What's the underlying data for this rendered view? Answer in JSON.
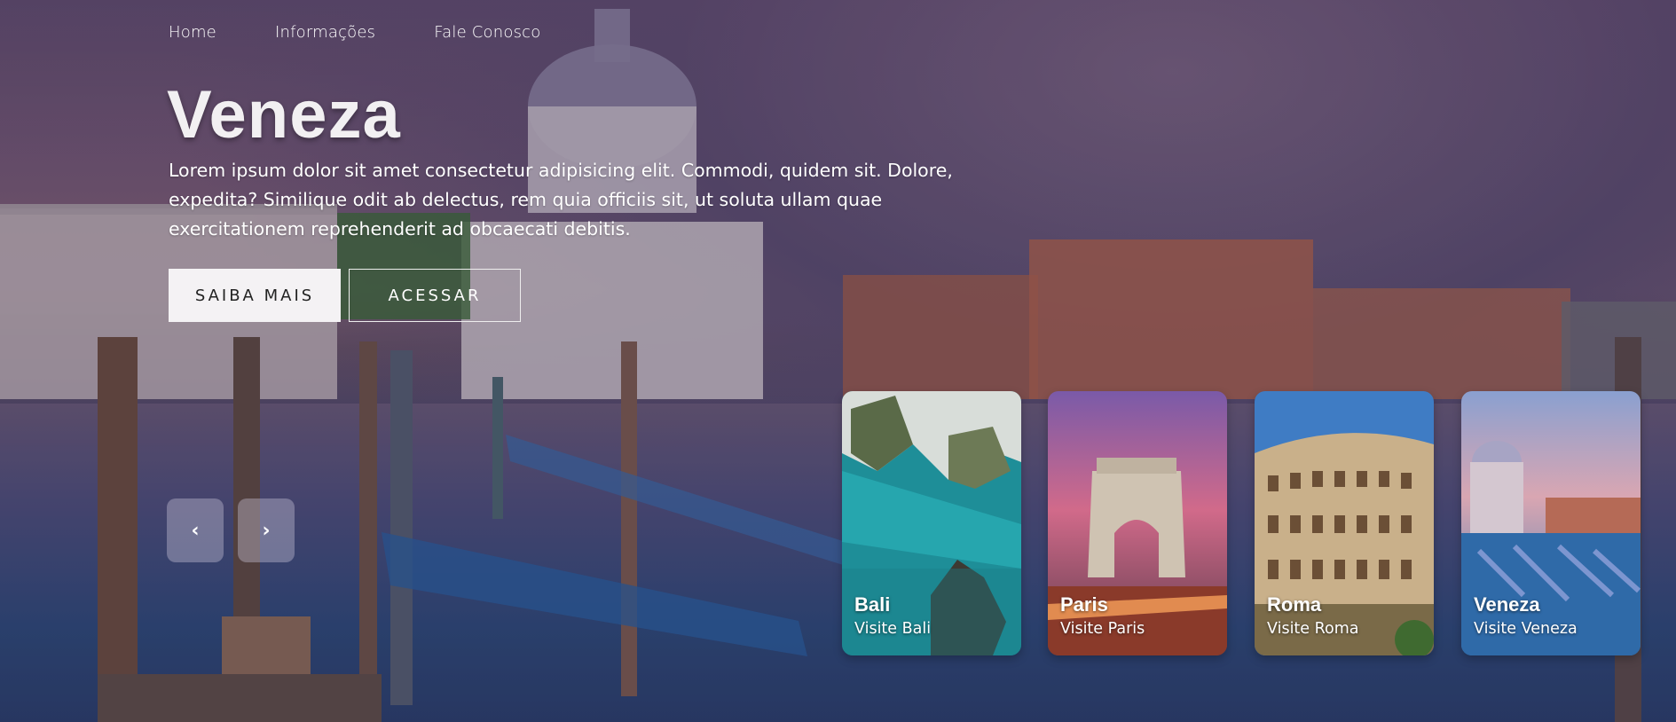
{
  "nav": {
    "items": [
      {
        "label": "Home"
      },
      {
        "label": "Informações"
      },
      {
        "label": "Fale Conosco"
      }
    ]
  },
  "hero": {
    "title": "Veneza",
    "description": "Lorem ipsum dolor sit amet consectetur adipisicing elit. Commodi, quidem sit. Dolore, expedita? Similique odit ab delectus, rem quia officiis sit, ut soluta ullam quae exercitationem reprehenderit ad obcaecati debitis.",
    "primary_button": "SAIBA MAIS",
    "secondary_button": "ACESSAR"
  },
  "controls": {
    "prev": "‹",
    "next": "›"
  },
  "cards": [
    {
      "name": "Bali",
      "subtitle": "Visite Bali"
    },
    {
      "name": "Paris",
      "subtitle": "Visite Paris"
    },
    {
      "name": "Roma",
      "subtitle": "Visite Roma"
    },
    {
      "name": "Veneza",
      "subtitle": "Visite Veneza"
    }
  ]
}
